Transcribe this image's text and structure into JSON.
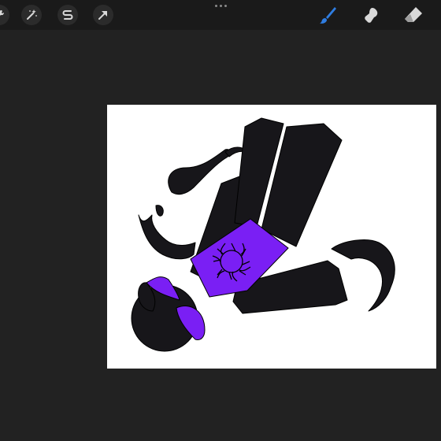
{
  "app": "Procreate",
  "toolbar": {
    "left_tools": [
      {
        "name": "actions-tool",
        "icon": "wrench-icon"
      },
      {
        "name": "adjustments-tool",
        "icon": "magic-wand-icon"
      },
      {
        "name": "selection-tool",
        "icon": "selection-s-icon"
      },
      {
        "name": "transform-tool",
        "icon": "arrow-cursor-icon"
      }
    ],
    "right_tools": [
      {
        "name": "brush-tool",
        "icon": "brush-icon",
        "active": true
      },
      {
        "name": "smudge-tool",
        "icon": "smudge-finger-icon",
        "active": false
      },
      {
        "name": "eraser-tool",
        "icon": "eraser-icon",
        "active": false
      }
    ]
  },
  "colors": {
    "background": "#222222",
    "toolbar": "#1a1a1a",
    "active_tool": "#2f7de1",
    "inactive_tool": "#d9d9d9",
    "canvas": "#ffffff",
    "drawing_black": "#17161a",
    "drawing_purple": "#7a1ff4"
  }
}
